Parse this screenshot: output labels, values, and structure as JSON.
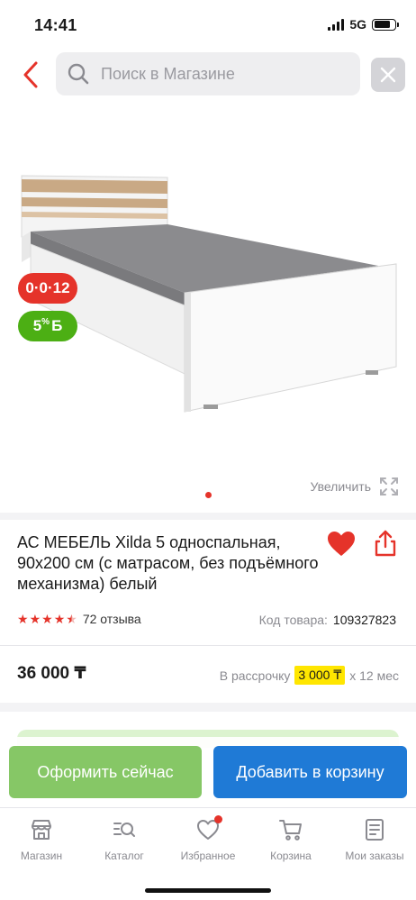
{
  "status_bar": {
    "time": "14:41",
    "network": "5G"
  },
  "search": {
    "placeholder": "Поиск в Магазине"
  },
  "badges": {
    "installment": "0·0·12",
    "bonus_value": "5",
    "bonus_suffix": "%",
    "bonus_currency": "Б"
  },
  "gallery": {
    "zoom_label": "Увеличить"
  },
  "product": {
    "title": "АС МЕБЕЛЬ Xilda 5 односпальная, 90x200 см (с матрасом, без подъёмного механизма) белый",
    "rating": 4.5,
    "reviews": "72 отзыва",
    "code_label": "Код товара:",
    "code_value": "109327823",
    "price": "36 000 ₸",
    "installment_label": "В рассрочку",
    "installment_amount": "3 000 ₸",
    "installment_term": "x 12 мес"
  },
  "actions": {
    "checkout": "Оформить сейчас",
    "add_to_cart": "Добавить в корзину"
  },
  "tab_bar": {
    "items": [
      {
        "label": "Магазин",
        "icon": "store-icon"
      },
      {
        "label": "Каталог",
        "icon": "catalog-search-icon"
      },
      {
        "label": "Избранное",
        "icon": "heart-icon"
      },
      {
        "label": "Корзина",
        "icon": "cart-icon"
      },
      {
        "label": "Мои заказы",
        "icon": "orders-icon"
      }
    ]
  },
  "colors": {
    "accent_red": "#e5332a",
    "bonus_green": "#4caf14",
    "checkout_green": "#86c766",
    "cart_blue": "#1f7ad6",
    "installment_yellow": "#ffe600"
  }
}
